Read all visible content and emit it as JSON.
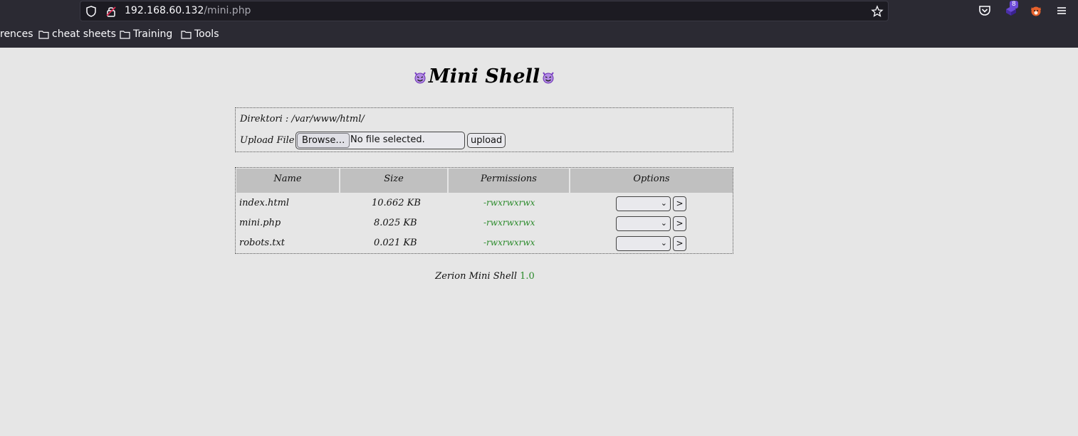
{
  "browser": {
    "url_host": "192.168.60.132",
    "url_path": "/mini.php",
    "extension_badge": "8",
    "bookmarks": [
      "rences",
      "cheat sheets",
      "Training",
      "Tools"
    ]
  },
  "page": {
    "title": "Mini Shell",
    "directory_text": "Direktori : /var/www/html/",
    "upload_label": "Upload File :",
    "browse_label": "Browse…",
    "file_status": "No file selected.",
    "upload_button": "upload",
    "table": {
      "headers": [
        "Name",
        "Size",
        "Permissions",
        "Options"
      ],
      "rows": [
        {
          "name": "index.html",
          "size": "10.662 KB",
          "perm": "-rwxrwxrwx",
          "go": ">"
        },
        {
          "name": "mini.php",
          "size": "8.025 KB",
          "perm": "-rwxrwxrwx",
          "go": ">"
        },
        {
          "name": "robots.txt",
          "size": "0.021 KB",
          "perm": "-rwxrwxrwx",
          "go": ">"
        }
      ]
    },
    "footer_text": "Zerion Mini Shell",
    "footer_version": "1.0"
  },
  "colors": {
    "chrome_bg": "#2b2a33",
    "page_bg": "#e6e6e6",
    "header_bg": "#c0c0c0",
    "accent_green": "#2a8a2a"
  }
}
